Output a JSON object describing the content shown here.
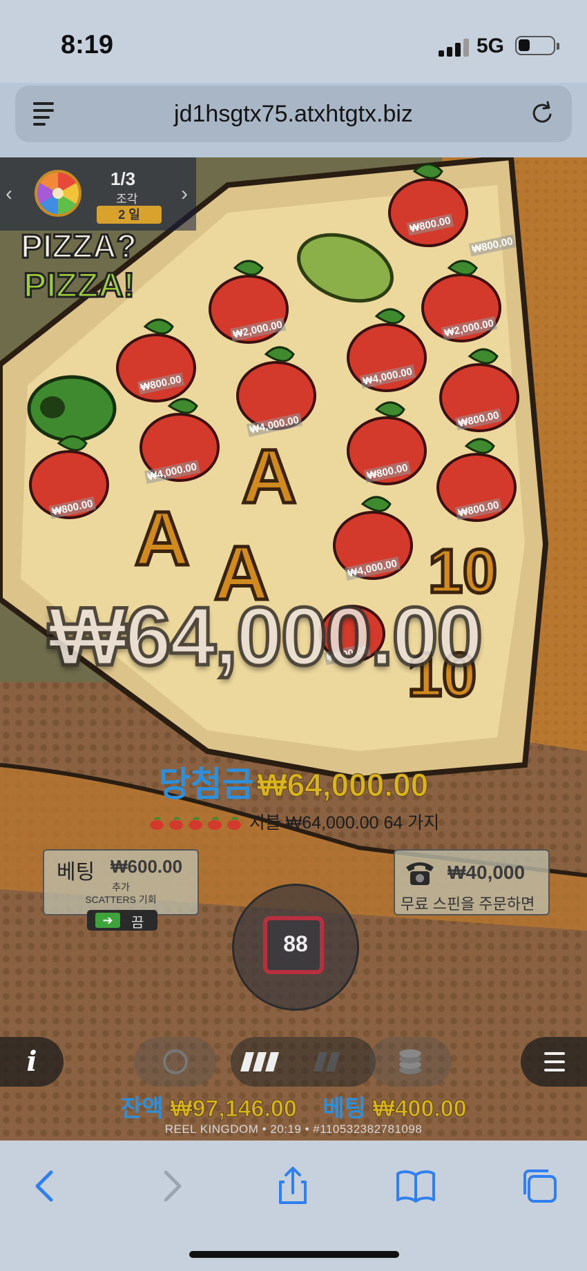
{
  "status_bar": {
    "time": "8:19",
    "network": "5G"
  },
  "browser": {
    "url": "jd1hsgtx75.atxhtgtx.biz"
  },
  "game": {
    "wheel": {
      "count": "1/3",
      "piece_label": "조각",
      "days": "2 일"
    },
    "logo": {
      "line1": "PIZZA?",
      "line2": "PIZZA!"
    },
    "big_win_amount": "₩64,000.00",
    "win": {
      "label": "당첨금",
      "amount": "₩64,000.00"
    },
    "payline": {
      "text": "지불 ₩64,000.00 64 가지"
    },
    "bet_box": {
      "label": "베팅",
      "amount": "₩600.00",
      "sub1": "추가",
      "sub2": "SCATTERS 기회",
      "toggle_label": "끔"
    },
    "spin": {
      "autoplay_count": "88"
    },
    "buy_free_spins": {
      "amount": "₩40,000",
      "text": "무료 스핀을 주문하면"
    },
    "balance": {
      "label": "잔액",
      "amount": "₩97,146.00",
      "bet_label": "베팅",
      "bet_amount": "₩400.00"
    },
    "footer": "REEL KINGDOM • 20:19 • #110532382781098",
    "reel_prize_labels": [
      "₩800.00",
      "₩2,000.00",
      "₩800.00",
      "₩4,000.00",
      "₩2,000.00",
      "₩4,000.00",
      "₩800.00",
      "₩4,000.00",
      "₩800.00",
      "₩800.00",
      "₩800.00",
      "₩800.00",
      "₩4,000.00",
      "₩800.00"
    ]
  },
  "colors": {
    "accent_blue": "#2f8fd8",
    "gold": "#d9b41e",
    "spin_red": "#b83040"
  }
}
